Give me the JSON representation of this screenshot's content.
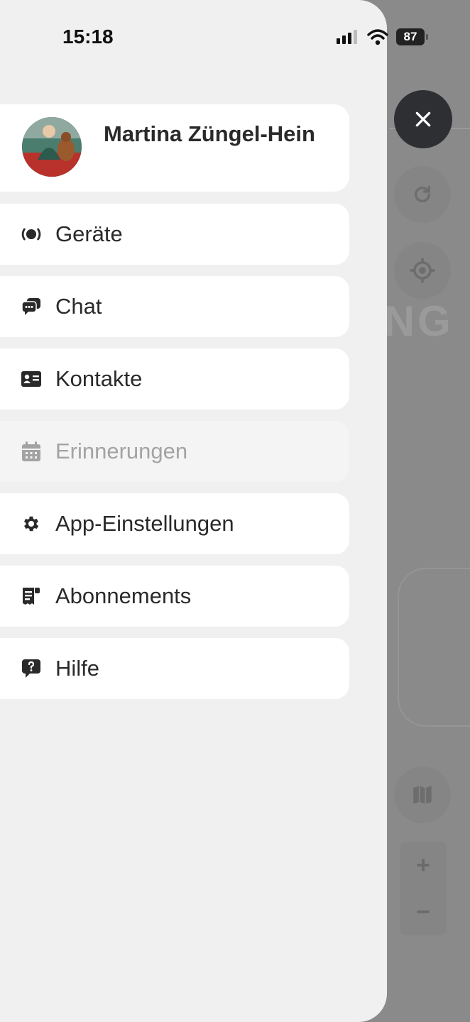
{
  "status_bar": {
    "time": "15:18",
    "battery": "87"
  },
  "profile": {
    "name": "Martina Züngel-Hein"
  },
  "menu": {
    "items": [
      {
        "label": "Geräte",
        "icon": "device-icon",
        "enabled": true
      },
      {
        "label": "Chat",
        "icon": "chat-icon",
        "enabled": true
      },
      {
        "label": "Kontakte",
        "icon": "contact-card-icon",
        "enabled": true
      },
      {
        "label": "Erinnerungen",
        "icon": "calendar-icon",
        "enabled": false
      },
      {
        "label": "App-Einstellungen",
        "icon": "gear-icon",
        "enabled": true
      },
      {
        "label": "Abonnements",
        "icon": "receipt-icon",
        "enabled": true
      },
      {
        "label": "Hilfe",
        "icon": "help-bubble-icon",
        "enabled": true
      }
    ]
  },
  "map": {
    "partial_label": "ING"
  },
  "colors": {
    "close_button": "#2d2f33",
    "drawer_bg": "#f0f0f0",
    "card_bg": "#ffffff",
    "disabled_text": "#a3a3a3"
  }
}
